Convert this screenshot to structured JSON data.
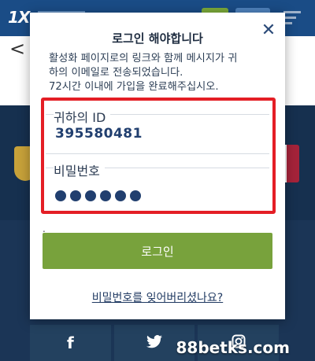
{
  "background": {
    "logo_text": "1X",
    "social": {
      "facebook_glyph": "f",
      "twitter_glyph": "🐦",
      "instagram_glyph": "◎"
    },
    "back_glyph": "<"
  },
  "modal": {
    "title": "로그인 해야합니다",
    "message_line1": "활성화 페이지로의 링크와 함께 메시지가 귀",
    "message_line2": "하의 이메일로 전송되었습니다.",
    "message_line3": "72시간 이내에 가입을 완료해주십시오.",
    "close_glyph": "✕",
    "id_field": {
      "label": "귀하의 ID",
      "value": "395580481"
    },
    "password_field": {
      "label": "비밀번호",
      "masked_length": 6
    },
    "small_mark": ".",
    "login_button_label": "로그인",
    "forgot_link_label": "비밀번호를 잊어버리셨나요?"
  },
  "watermark": "88betks.com",
  "colors": {
    "header_blue": "#1a4c86",
    "accent_green": "#78a23c",
    "highlight_red": "#e41e25",
    "value_navy": "#213f6f"
  }
}
